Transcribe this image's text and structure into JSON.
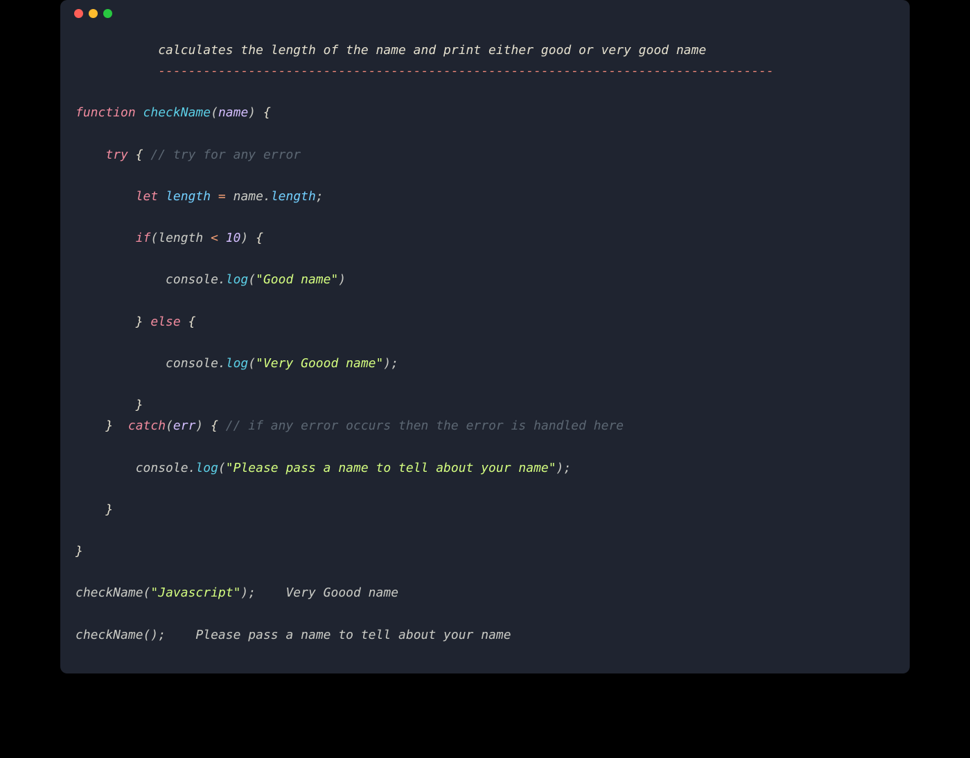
{
  "colors": {
    "background": "#1f2430",
    "keyword": "#f28c9f",
    "funcname": "#5ccfe6",
    "param": "#d4bfff",
    "comment": "#5c6773",
    "string": "#d5ff80",
    "property": "#73d0ff",
    "operator": "#f29e74",
    "text": "#cbccc6",
    "dashes": "#f28779"
  },
  "header": {
    "comment": "calculates the length of the name and print either good or very good name",
    "dashes": "----------------------------------------------------------------------------------"
  },
  "code": {
    "line_function": {
      "kw_function": "function",
      "name": "checkName",
      "paren_open": "(",
      "param": "name",
      "paren_close": ")",
      "brace": " {"
    },
    "line_try": {
      "kw_try": "try",
      "brace": " {",
      "comment": " // try for any error"
    },
    "line_let": {
      "kw_let": "let",
      "var": "length",
      "eq": " = ",
      "obj": "name",
      "dot": ".",
      "prop": "length",
      "semi": ";"
    },
    "line_if": {
      "kw_if": "if",
      "paren_open": "(",
      "var": "length",
      "op": " < ",
      "num": "10",
      "paren_close": ")",
      "brace": " {"
    },
    "line_log1": {
      "console": "console",
      "dot": ".",
      "method": "log",
      "paren_open": "(",
      "string": "\"Good name\"",
      "paren_close": ")"
    },
    "line_else": {
      "close_brace": "}",
      "kw_else": " else ",
      "open_brace": "{"
    },
    "line_log2": {
      "console": "console",
      "dot": ".",
      "method": "log",
      "paren_open": "(",
      "string": "\"Very Goood name\"",
      "paren_close": ")",
      "semi": ";"
    },
    "line_close_if": {
      "brace": "}"
    },
    "line_catch": {
      "close_brace": "}",
      "kw_catch": "  catch",
      "paren_open": "(",
      "param": "err",
      "paren_close": ")",
      "brace": " {",
      "comment": " // if any error occurs then the error is handled here"
    },
    "line_log3": {
      "console": "console",
      "dot": ".",
      "method": "log",
      "paren_open": "(",
      "string": "\"Please pass a name to tell about your name\"",
      "paren_close": ")",
      "semi": ";"
    },
    "line_close_catch": {
      "brace": "}"
    },
    "line_close_fn": {
      "brace": "}"
    },
    "line_call1": {
      "name": "checkName",
      "paren_open": "(",
      "string": "\"Javascript\"",
      "paren_close": ")",
      "semi": ";",
      "output": "    Very Goood name"
    },
    "line_call2": {
      "name": "checkName",
      "paren_open": "(",
      "paren_close": ")",
      "semi": ";",
      "output": "    Please pass a name to tell about your name"
    }
  }
}
